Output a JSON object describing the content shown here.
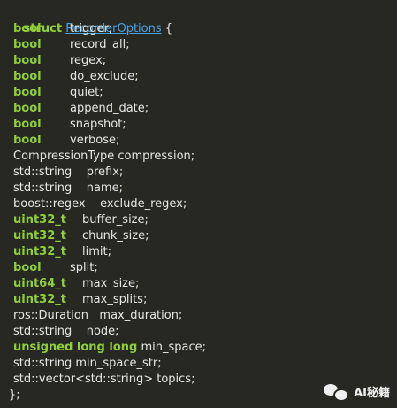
{
  "code": {
    "l1": {
      "kw": "struct",
      "name": "RecorderOptions",
      "tail": " {"
    },
    "l2": {
      "kw": "bool",
      "rest": "trigger;"
    },
    "l3": {
      "kw": "bool",
      "rest": "record_all;"
    },
    "l4": {
      "kw": "bool",
      "rest": "regex;"
    },
    "l5": {
      "kw": "bool",
      "rest": "do_exclude;"
    },
    "l6": {
      "kw": "bool",
      "rest": "quiet;"
    },
    "l7": {
      "kw": "bool",
      "rest": "append_date;"
    },
    "l8": {
      "kw": "bool",
      "rest": "snapshot;"
    },
    "l9": {
      "kw": "bool",
      "rest": "verbose;"
    },
    "l10": {
      "text": "CompressionType compression;"
    },
    "l11": {
      "text": "std::string    prefix;"
    },
    "l12": {
      "text": "std::string    name;"
    },
    "l13": {
      "text": "boost::regex    exclude_regex;"
    },
    "l14": {
      "kw": "uint32_t",
      "rest": "buffer_size;"
    },
    "l15": {
      "kw": "uint32_t",
      "rest": "chunk_size;"
    },
    "l16": {
      "kw": "uint32_t",
      "rest": "limit;"
    },
    "l17": {
      "kw": "bool",
      "rest": "split;"
    },
    "l18": {
      "kw": "uint64_t",
      "rest": "max_size;"
    },
    "l19": {
      "kw": "uint32_t",
      "rest": "max_splits;"
    },
    "l20": {
      "text": "ros::Duration   max_duration;"
    },
    "l21": {
      "text": "std::string    node;"
    },
    "l22": {
      "kw": "unsigned long long",
      "rest": "min_space;"
    },
    "l23": {
      "text": "std::string min_space_str;"
    },
    "l24": {
      "text": "std::vector<std::string> topics;"
    },
    "l25": {
      "text": "};"
    }
  },
  "watermark": {
    "label": "AI秘籍",
    "icon": "wechat-icon"
  },
  "colors": {
    "background": "#272822",
    "keyword": "#8fcf3a",
    "link": "#4aa3e0",
    "text": "#e6e6e6"
  }
}
